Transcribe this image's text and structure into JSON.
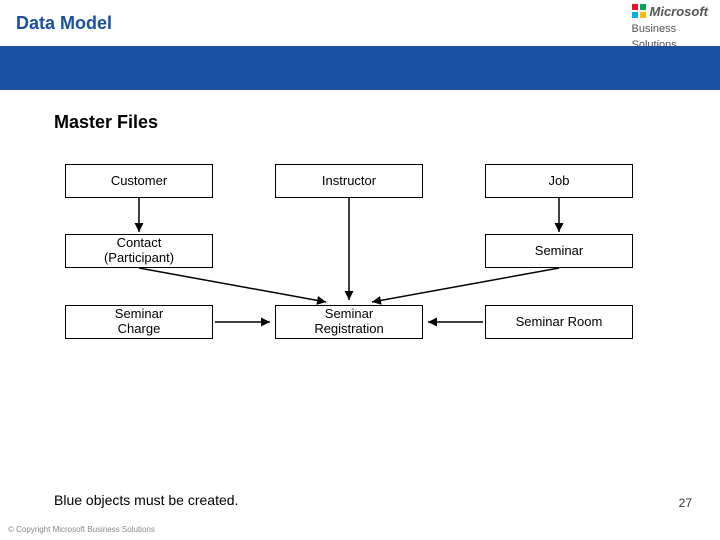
{
  "header": {
    "title": "Data Model",
    "logo": {
      "line1": "Microsoft",
      "line2": "Business",
      "line3": "Solutions"
    }
  },
  "subtitle": "Master Files",
  "entities": {
    "customer": "Customer",
    "instructor": "Instructor",
    "job": "Job",
    "contact": "Contact\n(Participant)",
    "seminar": "Seminar",
    "seminar_charge": "Seminar\nCharge",
    "seminar_registration": "Seminar\nRegistration",
    "seminar_room": "Seminar Room"
  },
  "footnote": "Blue objects must be created.",
  "page_number": "27",
  "copyright": "© Copyright Microsoft Business Solutions"
}
